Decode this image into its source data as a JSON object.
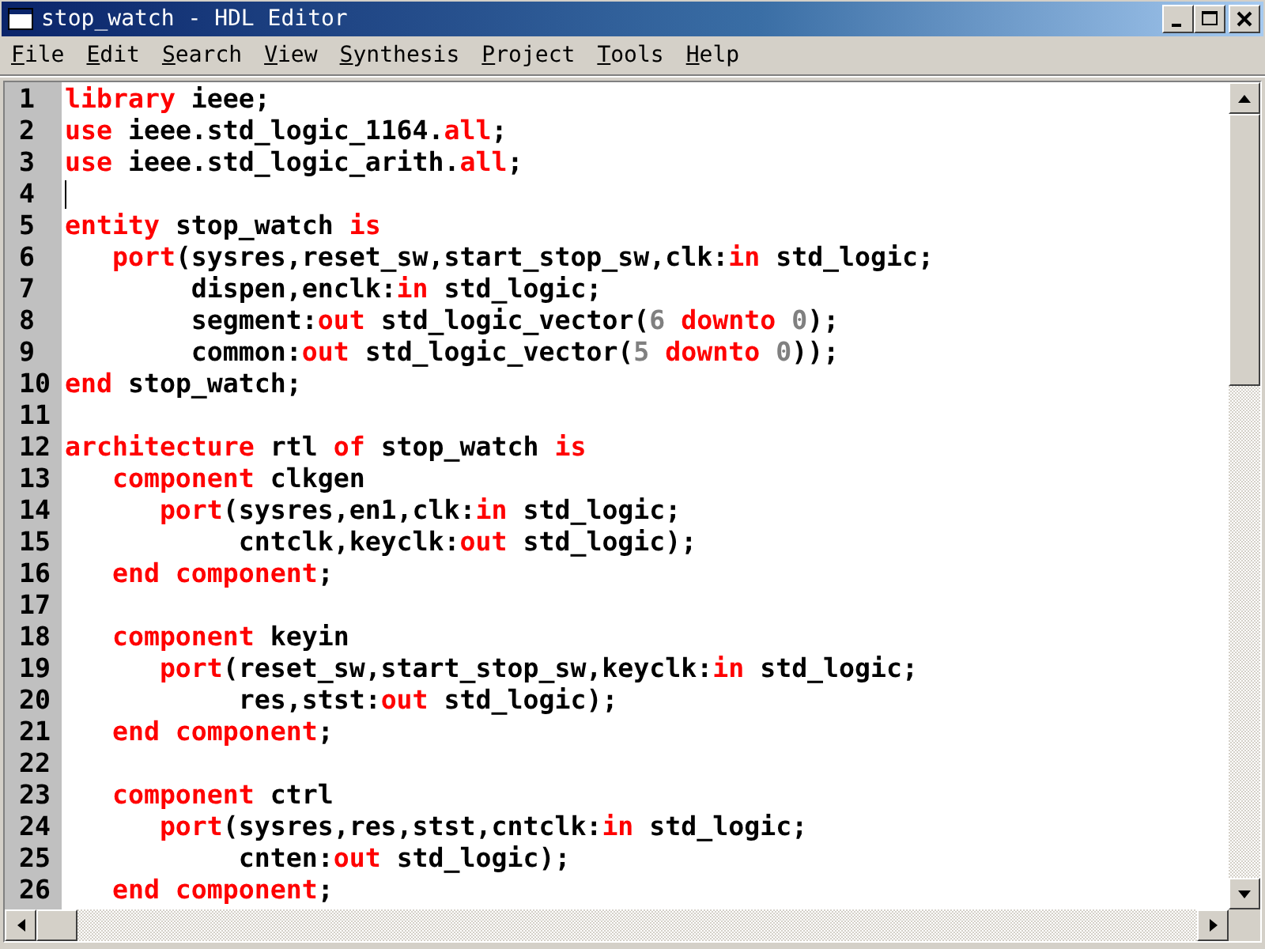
{
  "window": {
    "title": "stop_watch - HDL Editor"
  },
  "menu": [
    "File",
    "Edit",
    "Search",
    "View",
    "Synthesis",
    "Project",
    "Tools",
    "Help"
  ],
  "editor": {
    "lines": [
      {
        "number": "1",
        "caret": false,
        "tokens": [
          {
            "kind": "keyword",
            "text": "library"
          },
          {
            "kind": "plain",
            "text": " ieee;"
          }
        ]
      },
      {
        "number": "2",
        "caret": false,
        "tokens": [
          {
            "kind": "keyword",
            "text": "use"
          },
          {
            "kind": "plain",
            "text": " ieee.std_logic_1164."
          },
          {
            "kind": "keyword",
            "text": "all"
          },
          {
            "kind": "plain",
            "text": ";"
          }
        ]
      },
      {
        "number": "3",
        "caret": false,
        "tokens": [
          {
            "kind": "keyword",
            "text": "use"
          },
          {
            "kind": "plain",
            "text": " ieee.std_logic_arith."
          },
          {
            "kind": "keyword",
            "text": "all"
          },
          {
            "kind": "plain",
            "text": ";"
          }
        ]
      },
      {
        "number": "4",
        "caret": true
      },
      {
        "number": "5",
        "caret": false,
        "tokens": [
          {
            "kind": "keyword",
            "text": "entity"
          },
          {
            "kind": "plain",
            "text": " stop_watch "
          },
          {
            "kind": "keyword",
            "text": "is"
          }
        ]
      },
      {
        "number": "6",
        "caret": false,
        "tokens": [
          {
            "kind": "keyword",
            "text": "   port"
          },
          {
            "kind": "plain",
            "text": "(sysres,reset_sw,start_stop_sw,clk:"
          },
          {
            "kind": "keyword",
            "text": "in"
          },
          {
            "kind": "plain",
            "text": " std_logic;"
          }
        ]
      },
      {
        "number": "7",
        "caret": false,
        "tokens": [
          {
            "kind": "plain",
            "text": "        dispen,enclk:"
          },
          {
            "kind": "keyword",
            "text": "in"
          },
          {
            "kind": "plain",
            "text": " std_logic;"
          }
        ]
      },
      {
        "number": "8",
        "caret": false,
        "tokens": [
          {
            "kind": "plain",
            "text": "        segment:"
          },
          {
            "kind": "keyword",
            "text": "out"
          },
          {
            "kind": "plain",
            "text": " std_logic_vector("
          },
          {
            "kind": "number",
            "text": "6"
          },
          {
            "kind": "keyword",
            "text": " downto "
          },
          {
            "kind": "number",
            "text": "0"
          },
          {
            "kind": "plain",
            "text": ");"
          }
        ]
      },
      {
        "number": "9",
        "caret": false,
        "tokens": [
          {
            "kind": "plain",
            "text": "        common:"
          },
          {
            "kind": "keyword",
            "text": "out"
          },
          {
            "kind": "plain",
            "text": " std_logic_vector("
          },
          {
            "kind": "number",
            "text": "5"
          },
          {
            "kind": "keyword",
            "text": " downto "
          },
          {
            "kind": "number",
            "text": "0"
          },
          {
            "kind": "plain",
            "text": "));"
          }
        ]
      },
      {
        "number": "10",
        "caret": false,
        "tokens": [
          {
            "kind": "keyword",
            "text": "end"
          },
          {
            "kind": "plain",
            "text": " stop_watch;"
          }
        ]
      },
      {
        "number": "11",
        "caret": false
      },
      {
        "number": "12",
        "caret": false,
        "tokens": [
          {
            "kind": "keyword",
            "text": "architecture"
          },
          {
            "kind": "plain",
            "text": " rtl "
          },
          {
            "kind": "keyword",
            "text": "of"
          },
          {
            "kind": "plain",
            "text": " stop_watch "
          },
          {
            "kind": "keyword",
            "text": "is"
          }
        ]
      },
      {
        "number": "13",
        "caret": false,
        "tokens": [
          {
            "kind": "keyword",
            "text": "   component"
          },
          {
            "kind": "plain",
            "text": " clkgen"
          }
        ]
      },
      {
        "number": "14",
        "caret": false,
        "tokens": [
          {
            "kind": "keyword",
            "text": "      port"
          },
          {
            "kind": "plain",
            "text": "(sysres,en1,clk:"
          },
          {
            "kind": "keyword",
            "text": "in"
          },
          {
            "kind": "plain",
            "text": " std_logic;"
          }
        ]
      },
      {
        "number": "15",
        "caret": false,
        "tokens": [
          {
            "kind": "plain",
            "text": "           cntclk,keyclk:"
          },
          {
            "kind": "keyword",
            "text": "out"
          },
          {
            "kind": "plain",
            "text": " std_logic);"
          }
        ]
      },
      {
        "number": "16",
        "caret": false,
        "tokens": [
          {
            "kind": "keyword",
            "text": "   end component"
          },
          {
            "kind": "plain",
            "text": ";"
          }
        ]
      },
      {
        "number": "17",
        "caret": false
      },
      {
        "number": "18",
        "caret": false,
        "tokens": [
          {
            "kind": "keyword",
            "text": "   component"
          },
          {
            "kind": "plain",
            "text": " keyin"
          }
        ]
      },
      {
        "number": "19",
        "caret": false,
        "tokens": [
          {
            "kind": "keyword",
            "text": "      port"
          },
          {
            "kind": "plain",
            "text": "(reset_sw,start_stop_sw,keyclk:"
          },
          {
            "kind": "keyword",
            "text": "in"
          },
          {
            "kind": "plain",
            "text": " std_logic;"
          }
        ]
      },
      {
        "number": "20",
        "caret": false,
        "tokens": [
          {
            "kind": "plain",
            "text": "           res,stst:"
          },
          {
            "kind": "keyword",
            "text": "out"
          },
          {
            "kind": "plain",
            "text": " std_logic);"
          }
        ]
      },
      {
        "number": "21",
        "caret": false,
        "tokens": [
          {
            "kind": "keyword",
            "text": "   end component"
          },
          {
            "kind": "plain",
            "text": ";"
          }
        ]
      },
      {
        "number": "22",
        "caret": false
      },
      {
        "number": "23",
        "caret": false,
        "tokens": [
          {
            "kind": "keyword",
            "text": "   component"
          },
          {
            "kind": "plain",
            "text": " ctrl"
          }
        ]
      },
      {
        "number": "24",
        "caret": false,
        "tokens": [
          {
            "kind": "keyword",
            "text": "      port"
          },
          {
            "kind": "plain",
            "text": "(sysres,res,stst,cntclk:"
          },
          {
            "kind": "keyword",
            "text": "in"
          },
          {
            "kind": "plain",
            "text": " std_logic;"
          }
        ]
      },
      {
        "number": "25",
        "caret": false,
        "tokens": [
          {
            "kind": "plain",
            "text": "           cnten:"
          },
          {
            "kind": "keyword",
            "text": "out"
          },
          {
            "kind": "plain",
            "text": " std_logic);"
          }
        ]
      },
      {
        "number": "26",
        "caret": false,
        "tokens": [
          {
            "kind": "keyword",
            "text": "   end component"
          },
          {
            "kind": "plain",
            "text": ";"
          }
        ]
      }
    ]
  }
}
